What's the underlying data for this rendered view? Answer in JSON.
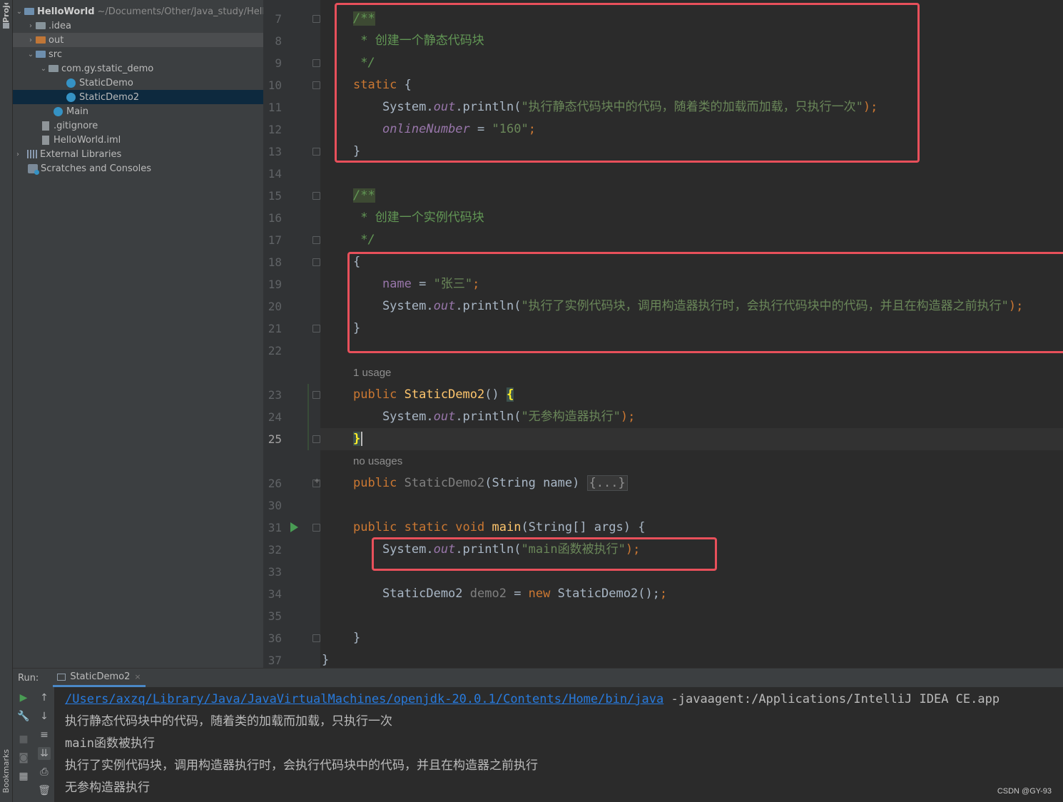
{
  "tool_strip": {
    "project_label": "Proje",
    "bookmarks_label": "Bookmarks"
  },
  "project_tree": {
    "root": {
      "name": "HelloWorld",
      "path": "~/Documents/Other/Java_study/HelloW"
    },
    "items": [
      {
        "label": ".idea"
      },
      {
        "label": "out"
      },
      {
        "label": "src"
      },
      {
        "label": "com.gy.static_demo"
      },
      {
        "label": "StaticDemo"
      },
      {
        "label": "StaticDemo2"
      },
      {
        "label": "Main"
      },
      {
        "label": ".gitignore"
      },
      {
        "label": "HelloWorld.iml"
      },
      {
        "label": "External Libraries"
      },
      {
        "label": "Scratches and Consoles"
      }
    ]
  },
  "editor": {
    "line_numbers": [
      "7",
      "8",
      "9",
      "10",
      "11",
      "12",
      "13",
      "14",
      "15",
      "16",
      "17",
      "18",
      "19",
      "20",
      "21",
      "22",
      "23",
      "24",
      "25",
      "26",
      "30",
      "31",
      "32",
      "33",
      "34",
      "35",
      "36",
      "37"
    ],
    "current_line": "25",
    "inlay_hints": {
      "usage_1": "1 usage",
      "usage_none": "no usages"
    },
    "code": {
      "l7": "/**",
      "l8_star": " * ",
      "l8_text": "创建一个静态代码块",
      "l9": " */",
      "l10_kw": "static",
      "l10_rest": " {",
      "l11_a": "    System.",
      "l11_out": "out",
      "l11_b": ".println(",
      "l11_str": "\"执行静态代码块中的代码，随着类的加载而加载，只执行一次\"",
      "l11_c": ");",
      "l12_field": "onlineNumber",
      "l12_eq": " = ",
      "l12_str": "\"160\"",
      "l12_semi": ";",
      "l13": "}",
      "l15": "/**",
      "l16_star": " * ",
      "l16_text": "创建一个实例代码块",
      "l17": " */",
      "l18": "{",
      "l19_field": "name",
      "l19_eq": " = ",
      "l19_str": "\"张三\"",
      "l19_semi": ";",
      "l20_a": "    System.",
      "l20_out": "out",
      "l20_b": ".println(",
      "l20_str": "\"执行了实例代码块，调用构造器执行时，会执行代码块中的代码，并且在构造器之前执行\"",
      "l20_c": ");",
      "l21": "}",
      "l23_kw": "public",
      "l23_name": "StaticDemo2",
      "l23_paren": "() ",
      "l23_brace": "{",
      "l24_a": "    System.",
      "l24_out": "out",
      "l24_b": ".println(",
      "l24_str": "\"无参构造器执行\"",
      "l24_c": ");",
      "l25_brace": "}",
      "l26_kw": "public",
      "l26_name": "StaticDemo2",
      "l26_params": "(String name) ",
      "l26_fold": "{...}",
      "l31_kw": "public static void",
      "l31_name": "main",
      "l31_rest": "(String[] args) {",
      "l32_a": "    System.",
      "l32_out": "out",
      "l32_b": ".println(",
      "l32_str": "\"main函数被执行\"",
      "l32_c": ");",
      "l34_type": "    StaticDemo2 ",
      "l34_var": "demo2",
      "l34_eq": " = ",
      "l34_new": "new",
      "l34_rest": " StaticDemo2();",
      "l36": "}",
      "l37": "}"
    }
  },
  "run_panel": {
    "run_label": "Run:",
    "tab_label": "StaticDemo2",
    "tab_close": "×",
    "console": {
      "path": "/Users/axzq/Library/Java/JavaVirtualMachines/openjdk-20.0.1/Contents/Home/bin/java",
      "args": " -javaagent:/Applications/IntelliJ IDEA CE.app",
      "out1": "执行静态代码块中的代码，随着类的加载而加载，只执行一次",
      "out2": "main函数被执行",
      "out3": "执行了实例代码块，调用构造器执行时，会执行代码块中的代码，并且在构造器之前执行",
      "out4": "无参构造器执行"
    }
  },
  "watermark": "CSDN @GY-93",
  "colors": {
    "highlight_box": "#e8505b",
    "keyword": "#cc7832",
    "string": "#6a8759",
    "doc_comment": "#629755",
    "field": "#9876aa",
    "method_decl": "#ffc66d",
    "selection": "#0d293e",
    "link": "#287bde"
  }
}
